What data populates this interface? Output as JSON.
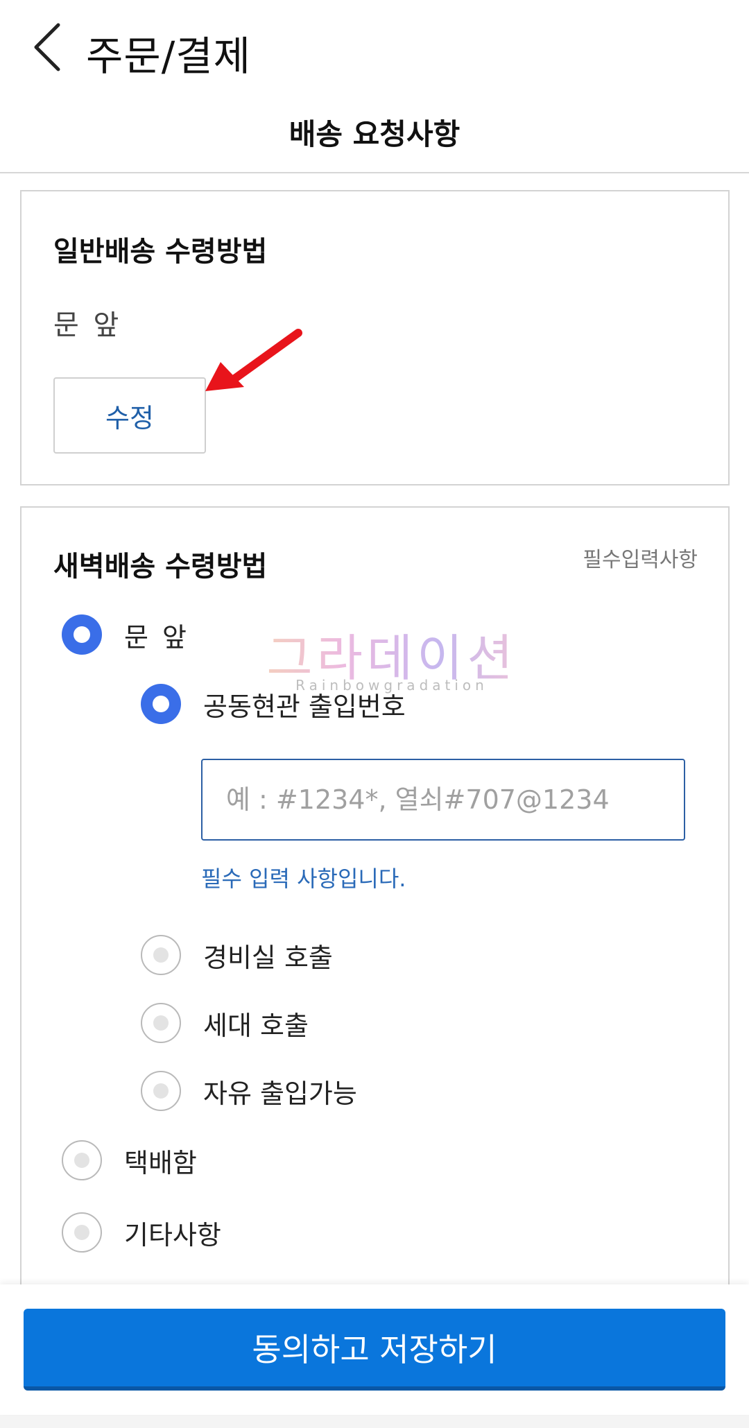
{
  "header": {
    "back_icon": "chevron-left-icon",
    "title": "주문/결제",
    "subtitle": "배송 요청사항"
  },
  "general_delivery": {
    "title": "일반배송 수령방법",
    "current_value": "문 앞",
    "edit_label": "수정"
  },
  "dawn_delivery": {
    "title": "새벽배송 수령방법",
    "required_note": "필수입력사항",
    "options": {
      "front_door": {
        "label": "문 앞",
        "selected": true
      },
      "entrance_code": {
        "label": "공동현관 출입번호",
        "selected": true
      },
      "security_office": {
        "label": "경비실 호출",
        "selected": false
      },
      "unit_call": {
        "label": "세대 호출",
        "selected": false
      },
      "free_access": {
        "label": "자유 출입가능",
        "selected": false
      },
      "parcel_box": {
        "label": "택배함",
        "selected": false
      },
      "other": {
        "label": "기타사항",
        "selected": false
      }
    },
    "code_input": {
      "placeholder": "예 : #1234*, 열쇠#707@1234",
      "value": ""
    },
    "error_message": "필수 입력 사항입니다."
  },
  "watermark": {
    "title": "그라데이션",
    "subtitle": "Rainbowgradation"
  },
  "footer": {
    "save_label": "동의하고 저장하기"
  },
  "colors": {
    "primary_button": "#0a76dc",
    "radio_selected": "#3a6ee8",
    "link_blue": "#1f5fa8",
    "annotation_arrow": "#e8141b"
  }
}
